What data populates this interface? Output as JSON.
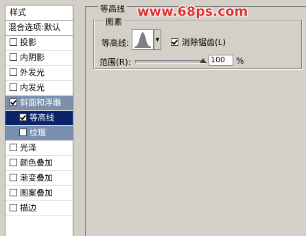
{
  "styles_panel": {
    "header": "样式",
    "blend_options": "混合选项:默认",
    "items": [
      {
        "label": "投影",
        "checked": false
      },
      {
        "label": "内阴影",
        "checked": false
      },
      {
        "label": "外发光",
        "checked": false
      },
      {
        "label": "内发光",
        "checked": false
      },
      {
        "label": "斜面和浮雕",
        "checked": true
      },
      {
        "label": "等高线",
        "checked": true
      },
      {
        "label": "纹理",
        "checked": false
      },
      {
        "label": "光泽",
        "checked": false
      },
      {
        "label": "颜色叠加",
        "checked": false
      },
      {
        "label": "渐变叠加",
        "checked": false
      },
      {
        "label": "图案叠加",
        "checked": false
      },
      {
        "label": "描边",
        "checked": false
      }
    ]
  },
  "contour_section": {
    "group_title": "等高线",
    "subgroup_title": "图素",
    "contour_label": "等高线:",
    "anti_alias_label": "消除锯齿(L)",
    "anti_alias_checked": true,
    "range_label": "范围(R):",
    "range_value": "100",
    "range_unit": "%"
  },
  "watermark": "www.68ps.com",
  "colors": {
    "panel_bg": "#d4d0c8",
    "selected_active": "#0a246a",
    "selected_parent": "#7b8fae",
    "watermark": "#dd3333"
  }
}
